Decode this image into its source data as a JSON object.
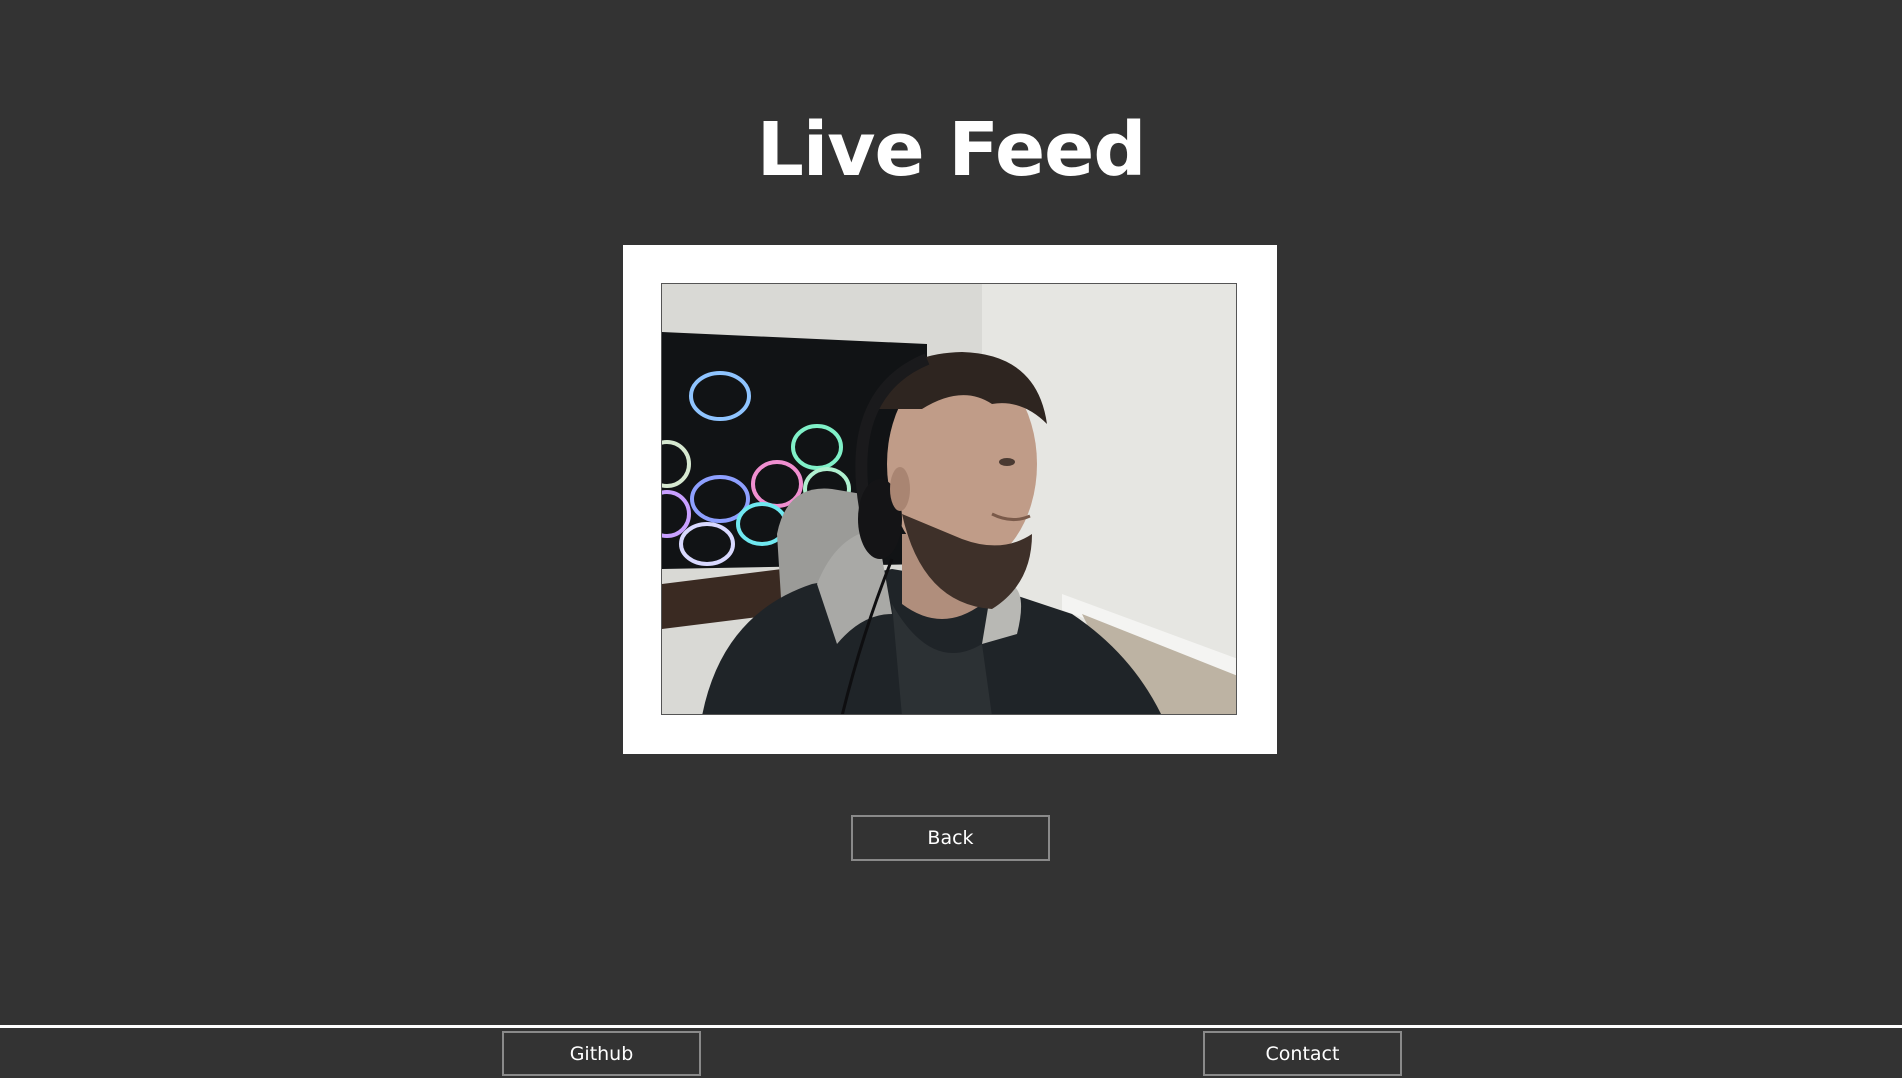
{
  "page": {
    "title": "Live Feed",
    "background_color": "#333333"
  },
  "feed": {
    "image_description_icon": "webcam-feed-image"
  },
  "buttons": {
    "back_label": "Back"
  },
  "footer": {
    "github_label": "Github",
    "contact_label": "Contact"
  }
}
